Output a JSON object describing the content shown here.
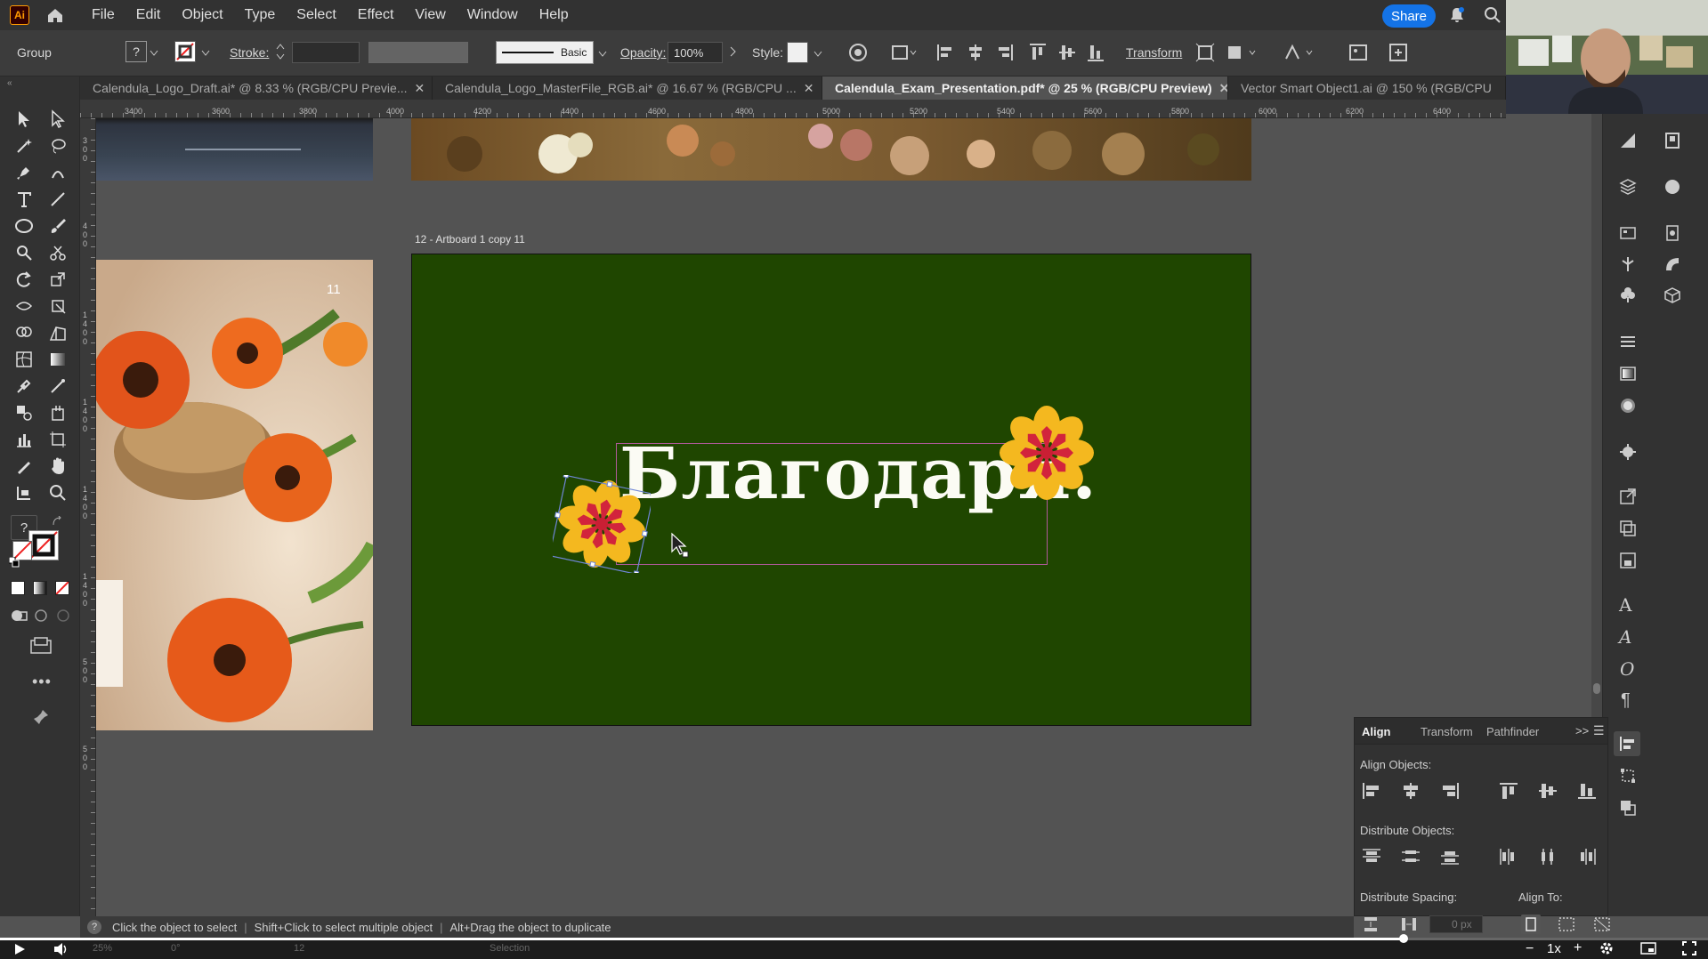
{
  "app": {
    "logo_text": "Ai"
  },
  "menubar": {
    "items": [
      "File",
      "Edit",
      "Object",
      "Type",
      "Select",
      "Effect",
      "View",
      "Window",
      "Help"
    ],
    "share_label": "Share"
  },
  "controlbar": {
    "selection_label": "Group",
    "stroke_label": "Stroke:",
    "stroke_style": "Basic",
    "opacity_label": "Opacity:",
    "opacity_value": "100%",
    "style_label": "Style:",
    "transform_label": "Transform"
  },
  "tabs": [
    {
      "label": "Calendula_Logo_Draft.ai* @ 8.33 % (RGB/CPU Previe...",
      "active": false
    },
    {
      "label": "Calendula_Logo_MasterFile_RGB.ai* @ 16.67 % (RGB/CPU ...",
      "active": false
    },
    {
      "label": "Calendula_Exam_Presentation.pdf* @ 25 % (RGB/CPU Preview)",
      "active": true
    },
    {
      "label": "Vector Smart Object1.ai @ 150 % (RGB/CPU",
      "active": false
    }
  ],
  "ruler": {
    "h_ticks": [
      "3400",
      "3600",
      "3800",
      "4000",
      "4200",
      "4400",
      "4600",
      "4800",
      "5000",
      "5200",
      "5400",
      "5600",
      "5800",
      "6000",
      "6200",
      "6400"
    ],
    "v_ticks": [
      "300",
      "400",
      "1400",
      "1400",
      "1400",
      "1400",
      "500",
      "500"
    ]
  },
  "canvas": {
    "artboard_name": "12 - Artboard 1 copy 11",
    "left_artboard_page_number": "11",
    "headline": "Благодаря."
  },
  "align_panel": {
    "tabs": [
      "Align",
      "Transform",
      "Pathfinder"
    ],
    "align_objects_label": "Align Objects:",
    "distribute_objects_label": "Distribute Objects:",
    "distribute_spacing_label": "Distribute Spacing:",
    "align_to_label": "Align To:",
    "spacing_value": "0 px"
  },
  "statusbar": {
    "hint_1": "Click the object to select",
    "hint_2": "Shift+Click to select multiple object",
    "hint_3": "Alt+Drag the object to duplicate",
    "zoom": "25%",
    "rotation": "0°",
    "page": "12",
    "mode": "Selection",
    "playback_speed": "1x"
  },
  "colors": {
    "artboard_green": "#1f4600",
    "flower_yellow": "#f4b81f",
    "flower_red": "#d2243c",
    "share_blue": "#1473e6",
    "selection_magenta": "#b05a9a"
  }
}
